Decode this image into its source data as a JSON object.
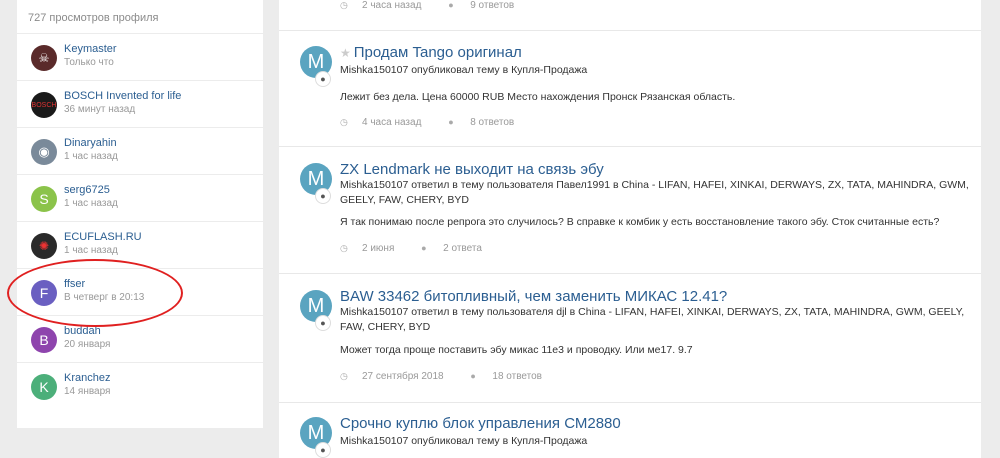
{
  "sidebar": {
    "profile_views": "727 просмотров профиля",
    "visitors": [
      {
        "name": "Keymaster",
        "time": "Только что",
        "avatar": "",
        "color": "#5a2a2a"
      },
      {
        "name": "BOSCH Invented for life",
        "time": "36 минут назад",
        "avatar": "",
        "color": "#1a1a1a"
      },
      {
        "name": "Dinaryahin",
        "time": "1 час назад",
        "avatar": "",
        "color": "#7a8a9a"
      },
      {
        "name": "serg6725",
        "time": "1 час назад",
        "avatar": "S",
        "color": "#8bc34a"
      },
      {
        "name": "ECUFLASH.RU",
        "time": "1 час назад",
        "avatar": "",
        "color": "#2a2a2a"
      },
      {
        "name": "ffser",
        "time": "В четверг в 20:13",
        "avatar": "F",
        "color": "#6a5fc1"
      },
      {
        "name": "buddah",
        "time": "20 января",
        "avatar": "B",
        "color": "#8e44ad"
      },
      {
        "name": "Kranchez",
        "time": "14 января",
        "avatar": "K",
        "color": "#4caf7a"
      }
    ]
  },
  "main": {
    "top_meta": {
      "time": "2 часа назад",
      "replies": "9 ответов"
    },
    "posts": [
      {
        "avatar": "M",
        "badge_icon": "comment-icon",
        "title": "Продам Tango оригинал",
        "starred": true,
        "author_line": "Mishka150107 опубликовал тему в Купля-Продажа",
        "snippet": "Лежит без дела. Цена 60000 RUB Место нахождения Пронск Рязанская область.",
        "time": "4 часа назад",
        "replies": "8 ответов"
      },
      {
        "avatar": "M",
        "badge_icon": "comment-icon",
        "title": "ZX Lendmark не выходит на связь эбу",
        "starred": false,
        "author_line": "Mishka150107 ответил в тему пользователя Павел1991 в China - LIFAN, HAFEI, XINKAI, DERWAYS, ZX, TATA, MAHINDRA, GWM, GEELY, FAW, CHERY, BYD",
        "snippet": "Я так понимаю после репрога это случилось? В справке к комбик у есть восстановление такого эбу. Сток считанные есть?",
        "time": "2 июня",
        "replies": "2 ответа"
      },
      {
        "avatar": "M",
        "badge_icon": "comment-icon",
        "title": "BAW 33462 битопливный, чем заменить МИКАС 12.41?",
        "starred": false,
        "author_line": "Mishka150107 ответил в тему пользователя djl в China - LIFAN, HAFEI, XINKAI, DERWAYS, ZX, TATA, MAHINDRA, GWM, GEELY, FAW, CHERY, BYD",
        "snippet": "Может тогда проще поставить эбу микас 11e3 и проводку. Или ме17. 9.7",
        "time": "27 сентября 2018",
        "replies": "18 ответов"
      },
      {
        "avatar": "M",
        "badge_icon": "comment-icon",
        "title": "Срочно куплю блок управления СМ2880",
        "starred": false,
        "author_line": "Mishka150107 опубликовал тему в Купля-Продажа",
        "snippet": "",
        "time": "",
        "replies": ""
      }
    ]
  },
  "colors": {
    "link": "#2b5e91",
    "annotation": "#e02020",
    "avatar_m": "#5aa4c0"
  }
}
